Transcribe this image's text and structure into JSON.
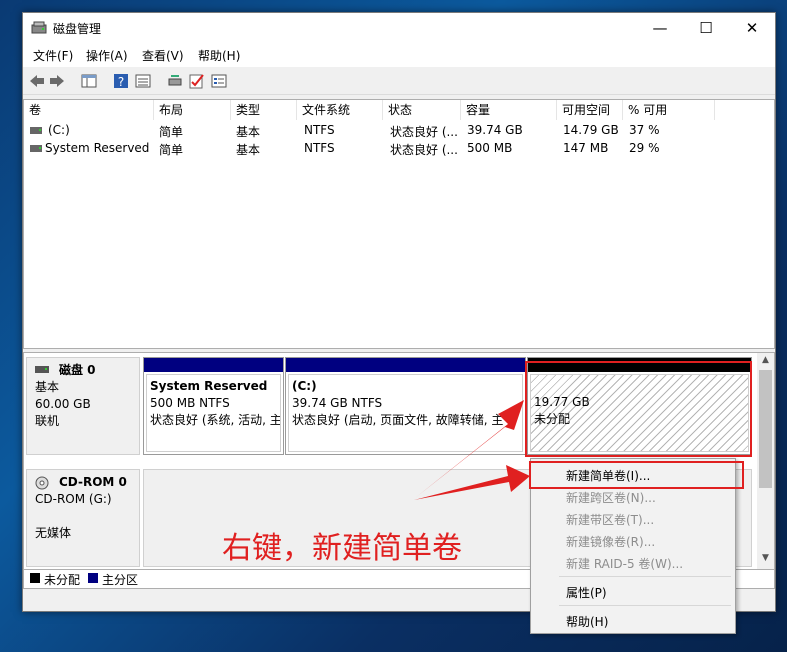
{
  "window": {
    "title": "磁盘管理",
    "minimize": "—",
    "maximize": "☐",
    "close": "✕"
  },
  "menu": [
    "文件(F)",
    "操作(A)",
    "查看(V)",
    "帮助(H)"
  ],
  "columns": [
    "卷",
    "布局",
    "类型",
    "文件系统",
    "状态",
    "容量",
    "可用空间",
    "% 可用"
  ],
  "volumes": [
    [
      "(C:)",
      "简单",
      "基本",
      "NTFS",
      "状态良好 (...",
      "39.74 GB",
      "14.79 GB",
      "37 %"
    ],
    [
      "System Reserved",
      "简单",
      "基本",
      "NTFS",
      "状态良好 (...",
      "500 MB",
      "147 MB",
      "29 %"
    ]
  ],
  "disk0": {
    "name": "磁盘 0",
    "type": "基本",
    "size": "60.00 GB",
    "state": "联机",
    "partitions": [
      {
        "name": "System Reserved",
        "size": "500 MB NTFS",
        "status": "状态良好 (系统, 活动, 主"
      },
      {
        "name": "(C:)",
        "size": "39.74 GB NTFS",
        "status": "状态良好 (启动, 页面文件, 故障转储, 主"
      },
      {
        "size": "19.77 GB",
        "status": "未分配"
      }
    ]
  },
  "cdrom": {
    "name": "CD-ROM 0",
    "type": "CD-ROM (G:)",
    "state": "无媒体"
  },
  "legend": [
    "未分配",
    "主分区"
  ],
  "context_menu": {
    "items": [
      "新建简单卷(I)...",
      "新建跨区卷(N)...",
      "新建带区卷(T)...",
      "新建镜像卷(R)...",
      "新建 RAID-5 卷(W)..."
    ],
    "properties": "属性(P)",
    "help": "帮助(H)"
  },
  "caption": "右键，新建简单卷",
  "colors": {
    "unallocated": "#000000",
    "primary": "#000080",
    "annotation": "#e02020"
  }
}
